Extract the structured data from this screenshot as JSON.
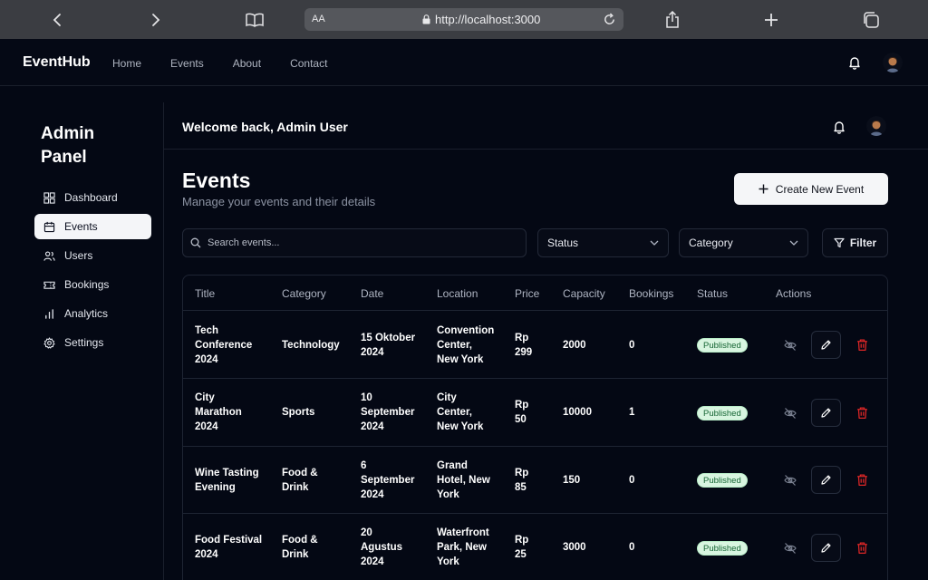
{
  "browser": {
    "aa_label": "AA",
    "url": "http://localhost:3000"
  },
  "header": {
    "brand": "EventHub",
    "nav": [
      "Home",
      "Events",
      "About",
      "Contact"
    ]
  },
  "sidebar": {
    "title": "Admin Panel",
    "items": [
      {
        "label": "Dashboard",
        "icon": "grid-icon"
      },
      {
        "label": "Events",
        "icon": "calendar-icon",
        "active": true
      },
      {
        "label": "Users",
        "icon": "users-icon"
      },
      {
        "label": "Bookings",
        "icon": "ticket-icon"
      },
      {
        "label": "Analytics",
        "icon": "bar-chart-icon"
      },
      {
        "label": "Settings",
        "icon": "gear-icon"
      }
    ]
  },
  "main": {
    "welcome": "Welcome back, Admin User",
    "title": "Events",
    "subtitle": "Manage your events and their details",
    "create_button": "Create New Event",
    "search_placeholder": "Search events...",
    "status_select": "Status",
    "category_select": "Category",
    "filter_button": "Filter"
  },
  "table": {
    "columns": [
      "Title",
      "Category",
      "Date",
      "Location",
      "Price",
      "Capacity",
      "Bookings",
      "Status",
      "Actions"
    ],
    "rows": [
      {
        "title": [
          "Tech",
          "Conference",
          "2024"
        ],
        "category": [
          "Technology"
        ],
        "date": [
          "15 Oktober",
          "2024"
        ],
        "location": [
          "Convention",
          "Center,",
          "New York"
        ],
        "price": [
          "Rp",
          "299"
        ],
        "capacity": "2000",
        "bookings": "0",
        "status": "Published"
      },
      {
        "title": [
          "City",
          "Marathon",
          "2024"
        ],
        "category": [
          "Sports"
        ],
        "date": [
          "10",
          "September",
          "2024"
        ],
        "location": [
          "City",
          "Center,",
          "New York"
        ],
        "price": [
          "Rp",
          "50"
        ],
        "capacity": "10000",
        "bookings": "1",
        "status": "Published"
      },
      {
        "title": [
          "Wine Tasting",
          "Evening"
        ],
        "category": [
          "Food &",
          "Drink"
        ],
        "date": [
          "6",
          "September",
          "2024"
        ],
        "location": [
          "Grand",
          "Hotel, New",
          "York"
        ],
        "price": [
          "Rp",
          "85"
        ],
        "capacity": "150",
        "bookings": "0",
        "status": "Published"
      },
      {
        "title": [
          "Food Festival",
          "2024"
        ],
        "category": [
          "Food &",
          "Drink"
        ],
        "date": [
          "20",
          "Agustus",
          "2024"
        ],
        "location": [
          "Waterfront",
          "Park, New",
          "York"
        ],
        "price": [
          "Rp",
          "25"
        ],
        "capacity": "3000",
        "bookings": "0",
        "status": "Published"
      }
    ]
  },
  "colors": {
    "background": "#040814",
    "badge_bg": "#d8f5e0",
    "badge_text": "#166534",
    "delete_red": "#dc2626"
  }
}
